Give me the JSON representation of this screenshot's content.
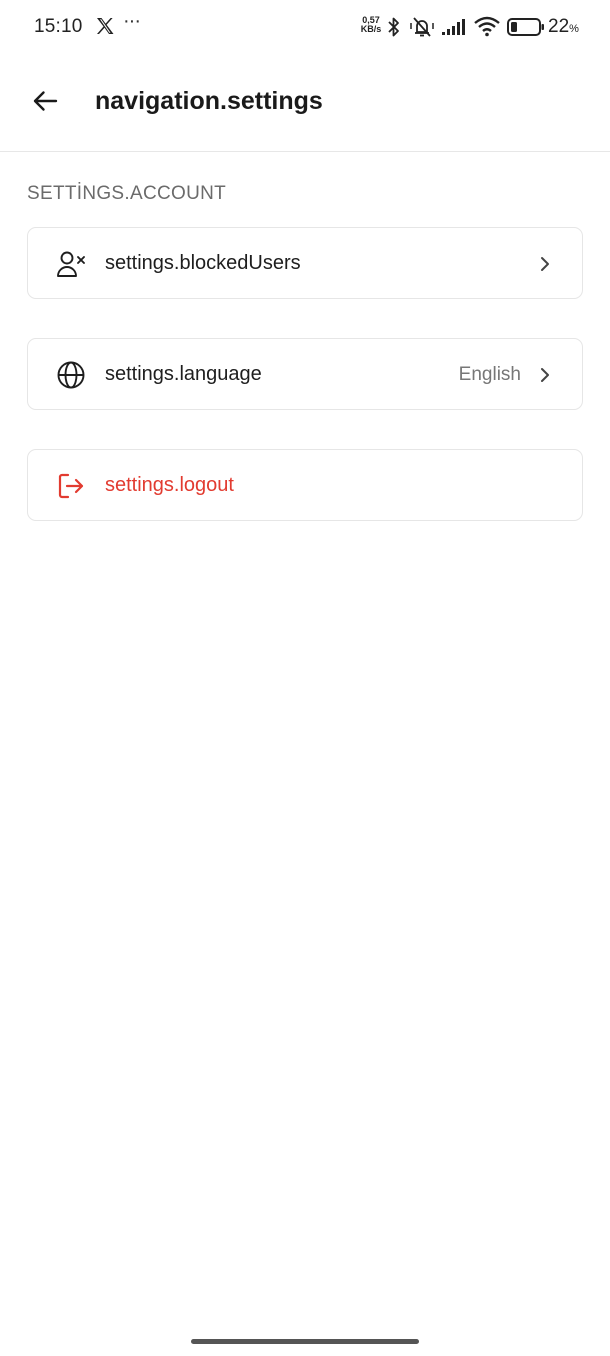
{
  "status_bar": {
    "time": "15:10",
    "more": "···",
    "net_speed_value": "0,57",
    "net_speed_unit": "KB/s",
    "battery_percent": "22",
    "battery_unit": "%",
    "battery_level": 0.22
  },
  "header": {
    "title": "navigation.settings"
  },
  "section": {
    "label": "SETTİNGS.ACCOUNT"
  },
  "rows": [
    {
      "label": "settings.blockedUsers",
      "icon": "user-x-icon"
    },
    {
      "label": "settings.language",
      "value": "English",
      "icon": "globe-icon"
    },
    {
      "label": "settings.logout",
      "icon": "logout-icon"
    }
  ],
  "colors": {
    "danger": "#e23b30",
    "text": "#1e1e1e",
    "muted": "#777777",
    "border": "#e6e6e6"
  }
}
